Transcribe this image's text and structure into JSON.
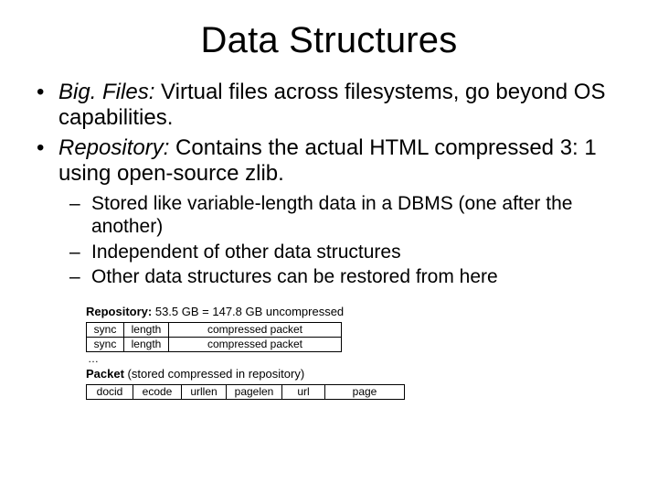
{
  "title": "Data Structures",
  "bullets": {
    "b1_label": "Big. Files:",
    "b1_rest": " Virtual files across filesystems, go beyond OS capabilities.",
    "b2_label": "Repository:",
    "b2_rest": " Contains the actual HTML compressed 3: 1 using open-source zlib.",
    "sub1": "Stored like variable-length data in a DBMS (one after the another)",
    "sub2": "Independent of other data structures",
    "sub3": "Other data structures can be restored from here"
  },
  "figure": {
    "repo_label": "Repository:",
    "repo_rest": " 53.5 GB = 147.8 GB uncompressed",
    "row_sync": "sync",
    "row_length": "length",
    "row_cpkt": "compressed packet",
    "dots": "…",
    "packet_label": "Packet",
    "packet_rest": " (stored compressed in repository)",
    "cells": {
      "docid": "docid",
      "ecode": "ecode",
      "urllen": "urllen",
      "pagelen": "pagelen",
      "url": "url",
      "page": "page"
    }
  }
}
